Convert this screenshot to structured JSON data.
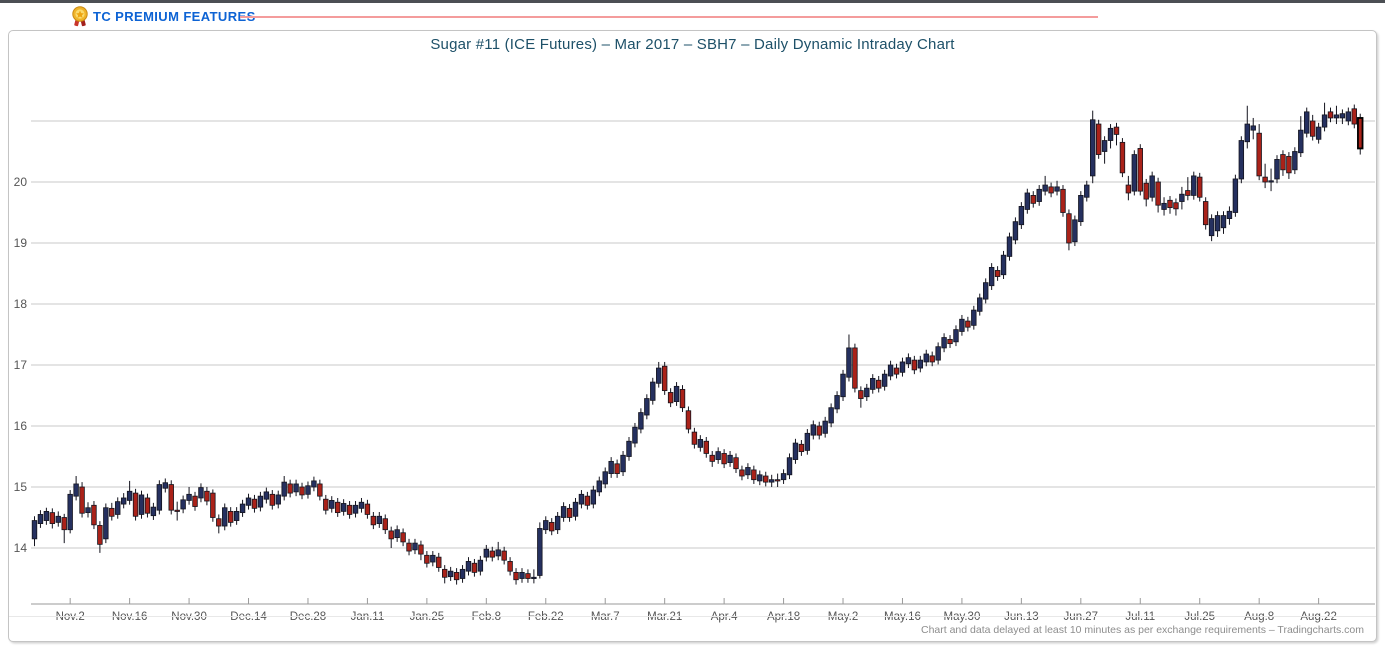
{
  "banner": {
    "label": "TC PREMIUM FEATURES",
    "icon": "medal-icon",
    "accent_color": "#0d63d4",
    "line_color": "#f49c9c"
  },
  "chart": {
    "footer": "Chart and data delayed at least 10 minutes as per exchange requirements – Tradingcharts.com"
  },
  "chart_data": {
    "type": "candlestick",
    "title": "Sugar #11 (ICE Futures) – Mar 2017 – SBH7 – Daily Dynamic Intraday Chart",
    "ylabel": "",
    "xlabel": "",
    "ylim": [
      13.1,
      21.45
    ],
    "grid_top_value": 21,
    "y_ticks": [
      20,
      19,
      18,
      17,
      16,
      15,
      14
    ],
    "x_tick_labels": [
      "Nov.2",
      "Nov.16",
      "Nov.30",
      "Dec.14",
      "Dec.28",
      "Jan.11",
      "Jan.25",
      "Feb.8",
      "Feb.22",
      "Mar.7",
      "Mar.21",
      "Apr.4",
      "Apr.18",
      "May.2",
      "May.16",
      "May.30",
      "Jun.13",
      "Jun.27",
      "Jul.11",
      "Jul.25",
      "Aug.8",
      "Aug.22"
    ],
    "x_tick_first_candle_index": 6,
    "x_tick_candle_step": 10,
    "grid_on": true,
    "up_color": "#25305f",
    "down_color": "#aa2219",
    "grid_color": "#c8c8c8",
    "axis_color": "#9a9a9a",
    "highlight_last": true,
    "candles_ohlc": [
      [
        14.15,
        14.52,
        14.03,
        14.45
      ],
      [
        14.4,
        14.62,
        14.33,
        14.55
      ],
      [
        14.45,
        14.66,
        14.38,
        14.6
      ],
      [
        14.58,
        14.65,
        14.32,
        14.4
      ],
      [
        14.42,
        14.6,
        14.35,
        14.52
      ],
      [
        14.5,
        14.56,
        14.08,
        14.3
      ],
      [
        14.3,
        14.95,
        14.24,
        14.88
      ],
      [
        14.85,
        15.18,
        14.78,
        15.05
      ],
      [
        15.0,
        15.08,
        14.5,
        14.57
      ],
      [
        14.58,
        14.75,
        14.5,
        14.66
      ],
      [
        14.7,
        14.77,
        14.31,
        14.38
      ],
      [
        14.37,
        14.44,
        13.92,
        14.06
      ],
      [
        14.15,
        14.73,
        14.08,
        14.66
      ],
      [
        14.65,
        14.74,
        14.45,
        14.52
      ],
      [
        14.55,
        14.83,
        14.48,
        14.76
      ],
      [
        14.72,
        14.9,
        14.65,
        14.82
      ],
      [
        14.78,
        15.1,
        14.71,
        14.93
      ],
      [
        14.9,
        14.97,
        14.45,
        14.52
      ],
      [
        14.55,
        14.94,
        14.48,
        14.87
      ],
      [
        14.82,
        14.89,
        14.5,
        14.57
      ],
      [
        14.53,
        14.74,
        14.46,
        14.67
      ],
      [
        14.62,
        15.11,
        14.55,
        15.04
      ],
      [
        14.98,
        15.14,
        14.91,
        15.07
      ],
      [
        15.04,
        15.11,
        14.55,
        14.62
      ],
      [
        14.62,
        14.76,
        14.45,
        14.6
      ],
      [
        14.64,
        14.86,
        14.57,
        14.79
      ],
      [
        14.78,
        15.0,
        14.71,
        14.88
      ],
      [
        14.85,
        14.92,
        14.61,
        14.68
      ],
      [
        14.82,
        15.06,
        14.75,
        14.99
      ],
      [
        14.93,
        15.0,
        14.7,
        14.77
      ],
      [
        14.9,
        14.96,
        14.43,
        14.5
      ],
      [
        14.48,
        14.55,
        14.24,
        14.36
      ],
      [
        14.36,
        14.73,
        14.29,
        14.66
      ],
      [
        14.6,
        14.67,
        14.35,
        14.42
      ],
      [
        14.45,
        14.67,
        14.38,
        14.6
      ],
      [
        14.58,
        14.79,
        14.51,
        14.72
      ],
      [
        14.7,
        14.89,
        14.63,
        14.82
      ],
      [
        14.8,
        14.87,
        14.58,
        14.65
      ],
      [
        14.67,
        14.92,
        14.6,
        14.85
      ],
      [
        14.8,
        14.99,
        14.73,
        14.92
      ],
      [
        14.88,
        14.95,
        14.63,
        14.7
      ],
      [
        14.72,
        14.94,
        14.65,
        14.87
      ],
      [
        14.85,
        15.18,
        14.78,
        15.08
      ],
      [
        15.05,
        15.12,
        14.83,
        14.9
      ],
      [
        14.92,
        15.12,
        14.85,
        15.05
      ],
      [
        15.0,
        15.07,
        14.8,
        14.87
      ],
      [
        14.88,
        15.09,
        14.81,
        15.02
      ],
      [
        15.0,
        15.17,
        14.93,
        15.1
      ],
      [
        15.05,
        15.12,
        14.78,
        14.85
      ],
      [
        14.8,
        14.87,
        14.55,
        14.62
      ],
      [
        14.65,
        14.85,
        14.58,
        14.78
      ],
      [
        14.75,
        14.82,
        14.51,
        14.58
      ],
      [
        14.6,
        14.8,
        14.53,
        14.73
      ],
      [
        14.7,
        14.77,
        14.48,
        14.55
      ],
      [
        14.57,
        14.77,
        14.5,
        14.7
      ],
      [
        14.65,
        14.82,
        14.58,
        14.75
      ],
      [
        14.72,
        14.79,
        14.48,
        14.55
      ],
      [
        14.52,
        14.59,
        14.31,
        14.38
      ],
      [
        14.4,
        14.59,
        14.33,
        14.52
      ],
      [
        14.48,
        14.55,
        14.23,
        14.3
      ],
      [
        14.28,
        14.35,
        14.0,
        14.15
      ],
      [
        14.17,
        14.37,
        14.1,
        14.3
      ],
      [
        14.25,
        14.32,
        14.03,
        14.1
      ],
      [
        14.08,
        14.15,
        13.88,
        13.95
      ],
      [
        13.97,
        14.15,
        13.9,
        14.08
      ],
      [
        14.05,
        14.12,
        13.8,
        13.9
      ],
      [
        13.88,
        13.95,
        13.68,
        13.75
      ],
      [
        13.77,
        13.95,
        13.7,
        13.88
      ],
      [
        13.85,
        13.92,
        13.61,
        13.68
      ],
      [
        13.65,
        13.72,
        13.42,
        13.52
      ],
      [
        13.53,
        13.69,
        13.46,
        13.62
      ],
      [
        13.6,
        13.67,
        13.4,
        13.48
      ],
      [
        13.5,
        13.72,
        13.43,
        13.65
      ],
      [
        13.62,
        13.85,
        13.55,
        13.78
      ],
      [
        13.75,
        13.82,
        13.53,
        13.6
      ],
      [
        13.62,
        13.87,
        13.55,
        13.8
      ],
      [
        13.85,
        14.05,
        13.78,
        13.98
      ],
      [
        13.95,
        14.02,
        13.78,
        13.85
      ],
      [
        13.87,
        14.1,
        13.8,
        13.97
      ],
      [
        13.95,
        14.02,
        13.73,
        13.8
      ],
      [
        13.78,
        13.85,
        13.55,
        13.62
      ],
      [
        13.6,
        13.67,
        13.4,
        13.48
      ],
      [
        13.5,
        13.67,
        13.43,
        13.6
      ],
      [
        13.58,
        13.65,
        13.43,
        13.5
      ],
      [
        13.52,
        13.65,
        13.42,
        13.52
      ],
      [
        13.55,
        14.42,
        13.5,
        14.32
      ],
      [
        14.3,
        14.52,
        14.23,
        14.45
      ],
      [
        14.42,
        14.49,
        14.21,
        14.28
      ],
      [
        14.3,
        14.59,
        14.23,
        14.52
      ],
      [
        14.5,
        14.75,
        14.43,
        14.68
      ],
      [
        14.65,
        14.72,
        14.43,
        14.5
      ],
      [
        14.52,
        14.82,
        14.45,
        14.75
      ],
      [
        14.72,
        14.95,
        14.65,
        14.88
      ],
      [
        14.85,
        14.92,
        14.63,
        14.7
      ],
      [
        14.72,
        15.02,
        14.65,
        14.95
      ],
      [
        14.92,
        15.17,
        14.85,
        15.1
      ],
      [
        15.05,
        15.32,
        14.98,
        15.25
      ],
      [
        15.22,
        15.49,
        15.15,
        15.42
      ],
      [
        15.38,
        15.45,
        15.15,
        15.22
      ],
      [
        15.25,
        15.59,
        15.18,
        15.52
      ],
      [
        15.5,
        15.82,
        15.43,
        15.75
      ],
      [
        15.72,
        16.05,
        15.65,
        15.98
      ],
      [
        15.95,
        16.29,
        15.88,
        16.22
      ],
      [
        16.18,
        16.52,
        16.11,
        16.45
      ],
      [
        16.42,
        16.79,
        16.35,
        16.72
      ],
      [
        16.7,
        17.05,
        16.63,
        16.95
      ],
      [
        16.98,
        17.05,
        16.51,
        16.58
      ],
      [
        16.55,
        16.62,
        16.31,
        16.38
      ],
      [
        16.4,
        16.72,
        16.33,
        16.65
      ],
      [
        16.6,
        16.67,
        16.23,
        16.3
      ],
      [
        16.25,
        16.32,
        15.88,
        15.95
      ],
      [
        15.9,
        15.97,
        15.63,
        15.7
      ],
      [
        15.65,
        15.85,
        15.58,
        15.78
      ],
      [
        15.75,
        15.82,
        15.48,
        15.55
      ],
      [
        15.52,
        15.59,
        15.33,
        15.42
      ],
      [
        15.45,
        15.65,
        15.38,
        15.58
      ],
      [
        15.55,
        15.62,
        15.31,
        15.38
      ],
      [
        15.4,
        15.59,
        15.33,
        15.52
      ],
      [
        15.48,
        15.55,
        15.23,
        15.3
      ],
      [
        15.28,
        15.35,
        15.11,
        15.18
      ],
      [
        15.2,
        15.39,
        15.13,
        15.32
      ],
      [
        15.28,
        15.35,
        15.05,
        15.12
      ],
      [
        15.1,
        15.27,
        15.03,
        15.2
      ],
      [
        15.18,
        15.25,
        15.01,
        15.08
      ],
      [
        15.08,
        15.2,
        15.0,
        15.12
      ],
      [
        15.12,
        15.22,
        15.0,
        15.1
      ],
      [
        15.12,
        15.29,
        15.05,
        15.22
      ],
      [
        15.2,
        15.55,
        15.13,
        15.48
      ],
      [
        15.45,
        15.79,
        15.38,
        15.72
      ],
      [
        15.7,
        15.77,
        15.51,
        15.58
      ],
      [
        15.6,
        15.95,
        15.53,
        15.88
      ],
      [
        15.85,
        16.09,
        15.78,
        16.02
      ],
      [
        16.0,
        16.07,
        15.78,
        15.85
      ],
      [
        15.88,
        16.15,
        15.81,
        16.08
      ],
      [
        16.05,
        16.37,
        15.98,
        16.3
      ],
      [
        16.28,
        16.57,
        16.21,
        16.5
      ],
      [
        16.48,
        16.92,
        16.41,
        16.85
      ],
      [
        16.8,
        17.5,
        16.73,
        17.28
      ],
      [
        17.28,
        17.35,
        16.55,
        16.62
      ],
      [
        16.58,
        16.65,
        16.3,
        16.45
      ],
      [
        16.48,
        16.69,
        16.41,
        16.62
      ],
      [
        16.6,
        16.85,
        16.53,
        16.78
      ],
      [
        16.75,
        16.82,
        16.55,
        16.62
      ],
      [
        16.65,
        16.92,
        16.58,
        16.85
      ],
      [
        16.82,
        17.07,
        16.75,
        17.0
      ],
      [
        16.95,
        17.02,
        16.78,
        16.85
      ],
      [
        16.88,
        17.12,
        16.81,
        17.05
      ],
      [
        17.02,
        17.19,
        16.95,
        17.12
      ],
      [
        17.08,
        17.15,
        16.85,
        16.92
      ],
      [
        16.95,
        17.15,
        16.88,
        17.08
      ],
      [
        17.05,
        17.25,
        16.98,
        17.18
      ],
      [
        17.15,
        17.22,
        16.98,
        17.05
      ],
      [
        17.08,
        17.37,
        17.01,
        17.3
      ],
      [
        17.28,
        17.52,
        17.21,
        17.45
      ],
      [
        17.42,
        17.49,
        17.28,
        17.35
      ],
      [
        17.38,
        17.65,
        17.31,
        17.58
      ],
      [
        17.55,
        17.82,
        17.48,
        17.75
      ],
      [
        17.72,
        17.79,
        17.55,
        17.62
      ],
      [
        17.65,
        17.97,
        17.58,
        17.9
      ],
      [
        17.88,
        18.17,
        17.81,
        18.1
      ],
      [
        18.08,
        18.42,
        18.01,
        18.35
      ],
      [
        18.3,
        18.67,
        18.23,
        18.6
      ],
      [
        18.55,
        18.62,
        18.38,
        18.45
      ],
      [
        18.48,
        18.87,
        18.41,
        18.8
      ],
      [
        18.78,
        19.17,
        18.71,
        19.1
      ],
      [
        19.05,
        19.42,
        18.98,
        19.35
      ],
      [
        19.3,
        19.67,
        19.23,
        19.6
      ],
      [
        19.55,
        19.89,
        19.48,
        19.82
      ],
      [
        19.78,
        19.85,
        19.58,
        19.65
      ],
      [
        19.68,
        19.95,
        19.61,
        19.88
      ],
      [
        19.85,
        20.1,
        19.78,
        19.95
      ],
      [
        19.92,
        19.99,
        19.75,
        19.82
      ],
      [
        19.85,
        20.02,
        19.78,
        19.92
      ],
      [
        19.88,
        19.95,
        19.43,
        19.5
      ],
      [
        19.48,
        19.55,
        18.88,
        19.0
      ],
      [
        19.02,
        19.45,
        18.95,
        19.38
      ],
      [
        19.35,
        19.85,
        19.28,
        19.78
      ],
      [
        19.75,
        20.02,
        19.68,
        19.95
      ],
      [
        20.1,
        21.17,
        19.98,
        21.02
      ],
      [
        20.95,
        21.02,
        20.38,
        20.45
      ],
      [
        20.5,
        20.75,
        20.3,
        20.68
      ],
      [
        20.68,
        20.95,
        20.55,
        20.88
      ],
      [
        20.9,
        20.97,
        20.6,
        20.78
      ],
      [
        20.65,
        20.72,
        20.08,
        20.15
      ],
      [
        19.95,
        20.1,
        19.7,
        19.82
      ],
      [
        19.85,
        20.52,
        19.78,
        20.45
      ],
      [
        20.55,
        20.62,
        19.78,
        19.85
      ],
      [
        19.98,
        20.05,
        19.6,
        19.72
      ],
      [
        19.75,
        20.17,
        19.68,
        20.1
      ],
      [
        20.0,
        20.07,
        19.5,
        19.62
      ],
      [
        19.55,
        19.75,
        19.45,
        19.65
      ],
      [
        19.7,
        19.77,
        19.48,
        19.58
      ],
      [
        19.66,
        19.73,
        19.45,
        19.56
      ],
      [
        19.68,
        19.92,
        19.55,
        19.8
      ],
      [
        19.86,
        20.08,
        19.7,
        19.78
      ],
      [
        19.78,
        20.17,
        19.71,
        20.1
      ],
      [
        20.08,
        20.15,
        19.68,
        19.75
      ],
      [
        19.68,
        19.75,
        19.22,
        19.3
      ],
      [
        19.12,
        19.47,
        19.03,
        19.4
      ],
      [
        19.2,
        19.52,
        19.1,
        19.45
      ],
      [
        19.25,
        19.52,
        19.15,
        19.45
      ],
      [
        19.4,
        19.6,
        19.3,
        19.52
      ],
      [
        19.5,
        20.12,
        19.43,
        20.05
      ],
      [
        20.05,
        20.75,
        19.98,
        20.68
      ],
      [
        20.66,
        21.25,
        20.55,
        20.95
      ],
      [
        20.85,
        21.05,
        20.7,
        20.92
      ],
      [
        20.8,
        20.95,
        20.03,
        20.1
      ],
      [
        20.08,
        20.3,
        19.9,
        20.0
      ],
      [
        20.0,
        20.22,
        19.85,
        20.02
      ],
      [
        20.05,
        20.44,
        19.98,
        20.37
      ],
      [
        20.45,
        20.52,
        20.1,
        20.2
      ],
      [
        20.42,
        20.49,
        20.05,
        20.15
      ],
      [
        20.2,
        20.57,
        20.13,
        20.5
      ],
      [
        20.48,
        21.08,
        20.41,
        20.85
      ],
      [
        20.8,
        21.22,
        20.73,
        21.15
      ],
      [
        21.0,
        21.1,
        20.68,
        20.75
      ],
      [
        20.7,
        20.97,
        20.63,
        20.9
      ],
      [
        20.9,
        21.3,
        20.83,
        21.1
      ],
      [
        21.15,
        21.22,
        20.98,
        21.05
      ],
      [
        21.05,
        21.25,
        20.95,
        21.1
      ],
      [
        21.05,
        21.19,
        20.95,
        21.12
      ],
      [
        21.0,
        21.22,
        20.93,
        21.15
      ],
      [
        21.2,
        21.27,
        20.88,
        20.95
      ],
      [
        21.05,
        21.12,
        20.45,
        20.55
      ]
    ]
  }
}
